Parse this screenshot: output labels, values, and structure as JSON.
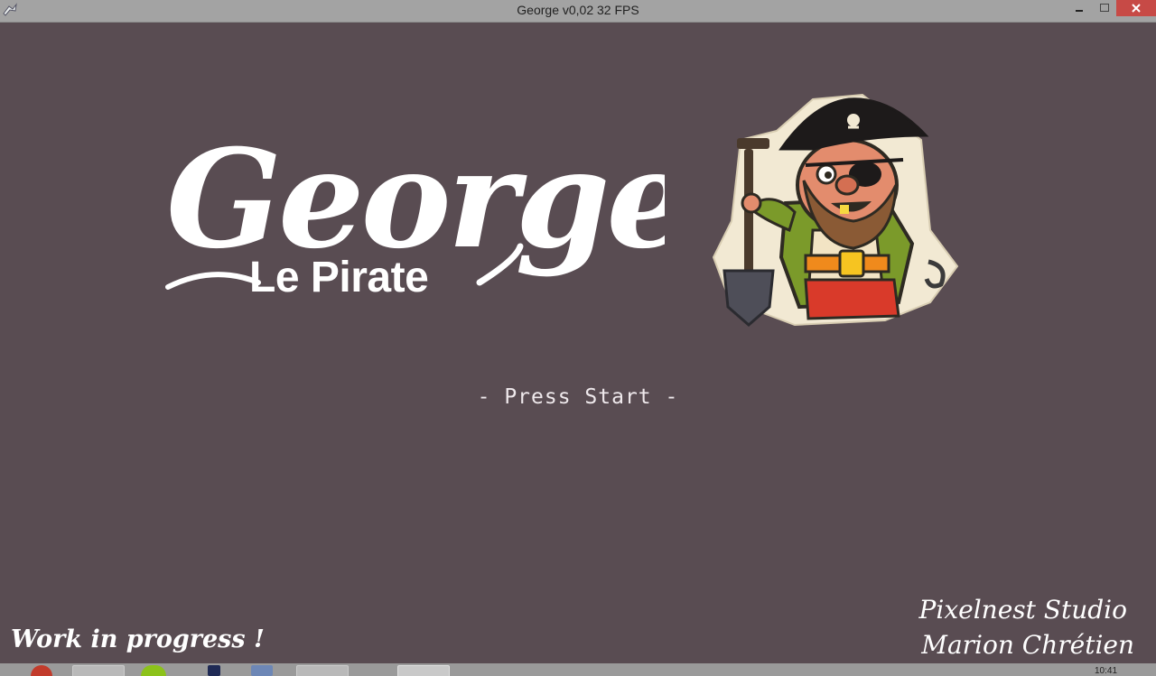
{
  "window": {
    "title": "George v0,02 32 FPS",
    "icons": {
      "app": "game-app-icon",
      "minimize": "minimize-icon",
      "maximize": "maximize-icon",
      "close": "close-icon"
    }
  },
  "logo": {
    "script_title": "George",
    "subtitle": "Le Pirate",
    "mascot": "pirate-mascot-icon"
  },
  "prompt": "- Press Start -",
  "footer": {
    "left_note": "Work in progress !",
    "studio": "Pixelnest Studio",
    "author": "Marion Chrétien"
  },
  "taskbar": {
    "clock": "10:41",
    "items": [
      "browser-icon",
      "file-explorer-icon",
      "media-player-icon",
      "document-icon",
      "image-viewer-icon",
      "spreadsheet-icon",
      "game-icon"
    ]
  },
  "colors": {
    "background": "#594c52",
    "titlebar": "#a3a3a3",
    "close_button": "#c74a46",
    "text": "#ffffff"
  }
}
